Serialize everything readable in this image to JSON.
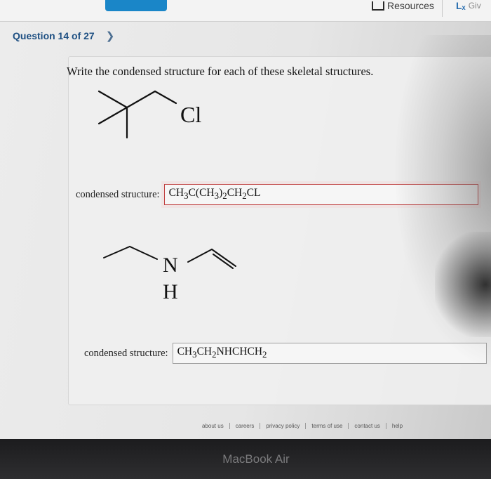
{
  "header": {
    "resources_label": "Resources",
    "give_label": "Giv"
  },
  "question_nav": {
    "label": "Question 14 of 27",
    "next_icon": "chevron-right-icon"
  },
  "prompt": "Write the condensed structure for each of these skeletal structures.",
  "structure1": {
    "atom_label": "Cl"
  },
  "answer1": {
    "label": "condensed structure:",
    "value_parts": [
      "CH",
      "3",
      "C(CH",
      "3",
      ")",
      "2",
      "CH",
      "2",
      "CL"
    ]
  },
  "structure2": {
    "n_label": "N",
    "h_label": "H"
  },
  "answer2": {
    "label": "condensed structure:",
    "value_parts": [
      "CH",
      "3",
      "CH",
      "2",
      "NHCHCH",
      "2"
    ]
  },
  "footer": {
    "links": [
      "about us",
      "careers",
      "privacy policy",
      "terms of use",
      "contact us",
      "help"
    ]
  },
  "device": {
    "brand": "MacBook Air"
  },
  "colors": {
    "link_blue": "#1d4f82",
    "error_border": "#c04040",
    "button_blue": "#1a86c8"
  }
}
